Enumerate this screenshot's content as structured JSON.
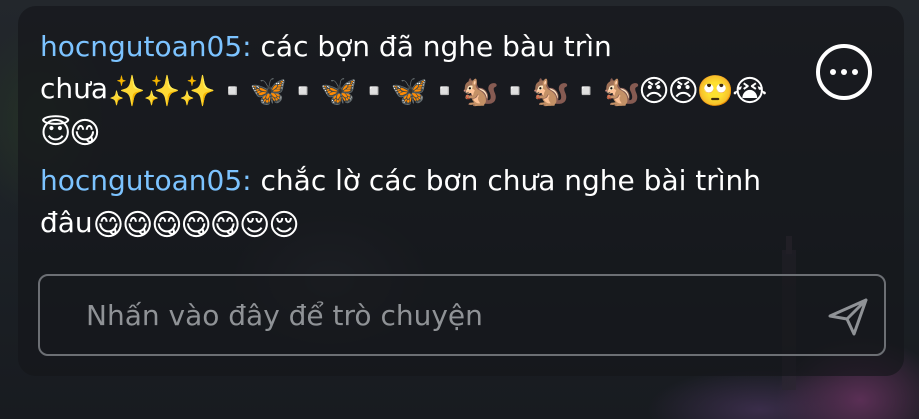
{
  "chat": {
    "messages": [
      {
        "username": "hocngutoan05:",
        "text": " các bợn đã nghe bàu trìn chưa",
        "emojis": "✨✨✨▫️🦋▫️🦋▫️🦋▫️🐿️▫️🐿️▫️🐿️😠😠🙄😭😇😋"
      },
      {
        "username": "hocngutoan05:",
        "text": " chắc lờ các bơn chưa nghe bài trình đâu",
        "emojis": "😋😋😋😋😋😌😌"
      }
    ],
    "input_placeholder": "Nhấn vào đây để trò chuyện"
  },
  "icons": {
    "more": "more-options-icon",
    "send": "send-icon"
  },
  "colors": {
    "username": "#7cc3ff",
    "text": "#ffffff",
    "placeholder": "#8f9296",
    "panel_background": "#14161a",
    "input_border": "#6c6f74"
  }
}
